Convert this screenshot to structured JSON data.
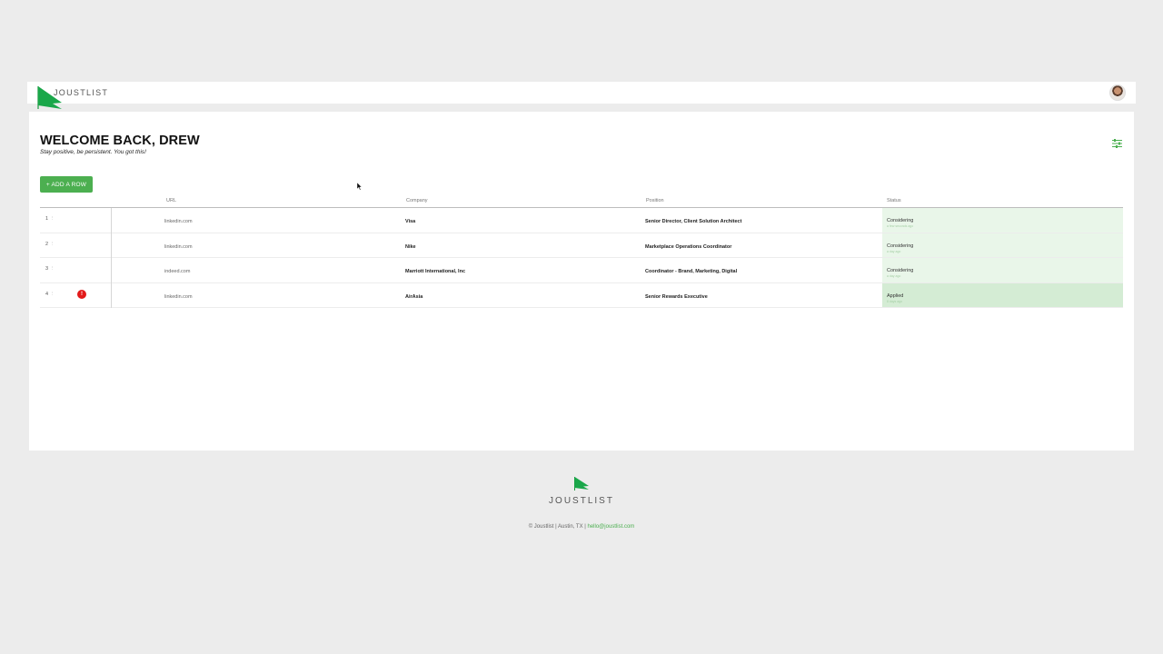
{
  "app": {
    "logo_text": "JOUSTLIST"
  },
  "header": {
    "title": "WELCOME BACK, DREW",
    "subtitle": "Stay positive, be persistent. You got this!",
    "add_row_label": "+ ADD A ROW"
  },
  "table": {
    "columns": {
      "url": "URL",
      "company": "Company",
      "position": "Position",
      "status": "Status"
    },
    "rows": [
      {
        "num": "1",
        "url": "linkedin.com",
        "company": "Visa",
        "position": "Senior Director, Client Solution Architect",
        "status": "Considering",
        "status_time": "a few seconds ago"
      },
      {
        "num": "2",
        "url": "linkedin.com",
        "company": "Nike",
        "position": "Marketplace Operations Coordinator",
        "status": "Considering",
        "status_time": "a day ago"
      },
      {
        "num": "3",
        "url": "indeed.com",
        "company": "Marriott International, Inc",
        "position": "Coordinator - Brand, Marketing, Digital",
        "status": "Considering",
        "status_time": "a day ago"
      },
      {
        "num": "4",
        "url": "linkedin.com",
        "company": "AirAsia",
        "position": "Senior Rewards Executive",
        "status": "Applied",
        "status_time": "8 days ago"
      }
    ],
    "alert_badge": "!"
  },
  "footer": {
    "name": "JOUSTLIST",
    "copyright": "© Joustlist | Austin, TX |",
    "email": "hello@joustlist.com"
  },
  "colors": {
    "brand": "#4caf50",
    "alert": "#e21a1a",
    "status_considering": "#e9f6e9",
    "status_applied": "#d4ecd4"
  }
}
